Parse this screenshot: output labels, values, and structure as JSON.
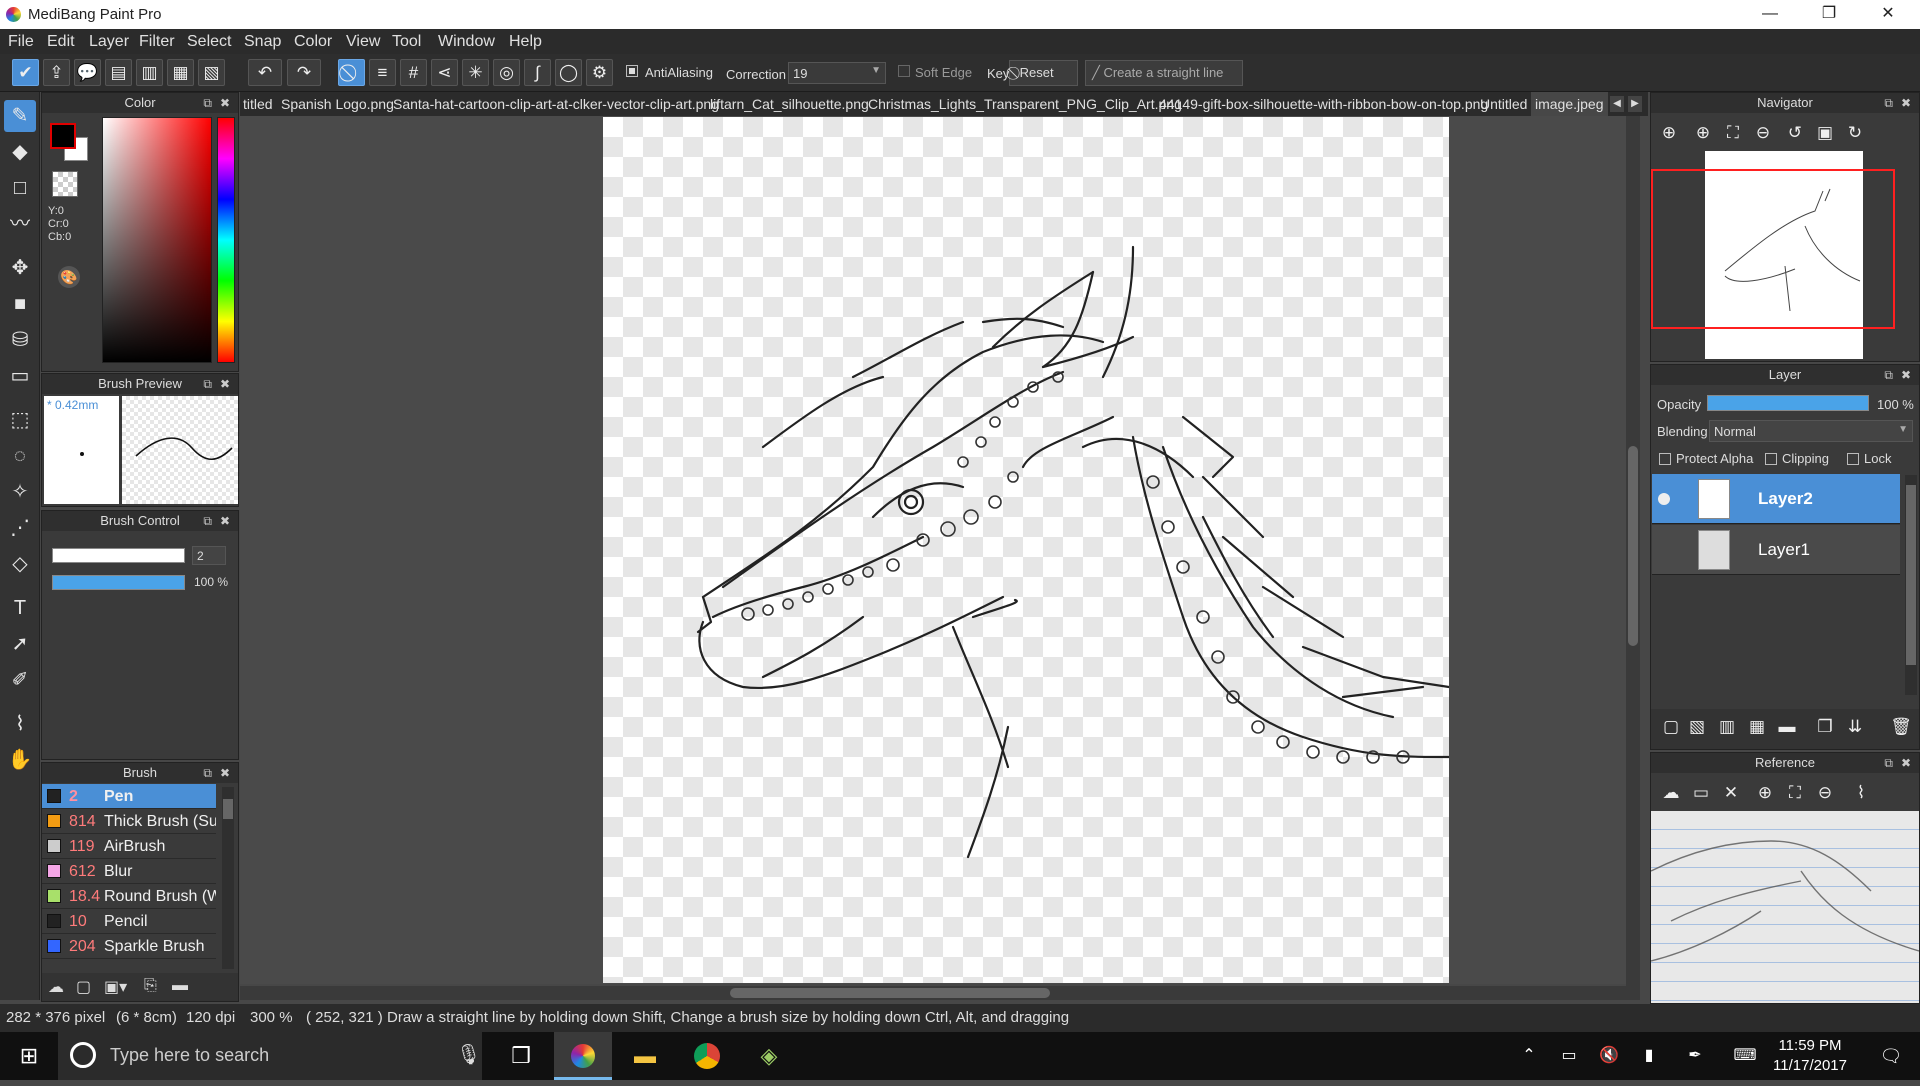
{
  "app": {
    "title": "MediBang Paint Pro"
  },
  "window_controls": {
    "minimize": "—",
    "maximize": "❐",
    "close": "✕"
  },
  "menu": [
    "File",
    "Edit",
    "Layer",
    "Filter",
    "Select",
    "Snap",
    "Color",
    "View",
    "Tool",
    "Window",
    "Help"
  ],
  "toolbar": {
    "antialiasing_label": "AntiAliasing",
    "correction_label": "Correction",
    "correction_value": "19",
    "soft_edge_label": "Soft Edge",
    "key_label": "Key",
    "reset_label": "Reset",
    "straight_line_label": "Create a straight line"
  },
  "tabs": [
    "titled",
    "Spanish Logo.png",
    "Santa-hat-cartoon-clip-art-at-clker-vector-clip-art.png",
    "liftarn_Cat_silhouette.png",
    "Christmas_Lights_Transparent_PNG_Clip_Art.png",
    "44149-gift-box-silhouette-with-ribbon-bow-on-top.png",
    "Untitled",
    "image.jpeg"
  ],
  "color_panel": {
    "title": "Color",
    "y": "Y:0",
    "cr": "Cr:0",
    "cb": "Cb:0",
    "foreground": "#e00000",
    "background": "#ffffff"
  },
  "brush_preview": {
    "title": "Brush Preview",
    "size": "* 0.42mm"
  },
  "brush_control": {
    "title": "Brush Control",
    "size_value": "2",
    "opacity_value": "100 %"
  },
  "brush_list": {
    "title": "Brush",
    "items": [
      {
        "num": "2",
        "name": "Pen",
        "color": "#222222"
      },
      {
        "num": "814",
        "name": "Thick Brush (Su",
        "color": "#f39c12"
      },
      {
        "num": "119",
        "name": "AirBrush",
        "color": "#cccccc"
      },
      {
        "num": "612",
        "name": "Blur",
        "color": "#f5a6e6"
      },
      {
        "num": "18.4",
        "name": "Round Brush (W",
        "color": "#a8e06a"
      },
      {
        "num": "10",
        "name": "Pencil",
        "color": "#222222"
      },
      {
        "num": "204",
        "name": "Sparkle Brush",
        "color": "#3366ff"
      }
    ]
  },
  "navigator": {
    "title": "Navigator"
  },
  "layer_panel": {
    "title": "Layer",
    "opacity_label": "Opacity",
    "opacity_value": "100 %",
    "blending_label": "Blending",
    "blending_value": "Normal",
    "protect_alpha": "Protect Alpha",
    "clipping": "Clipping",
    "lock": "Lock",
    "layers": [
      "Layer2",
      "Layer1"
    ]
  },
  "reference": {
    "title": "Reference"
  },
  "status": {
    "size": "282 * 376 pixel",
    "cm": "(6 * 8cm)",
    "dpi": "120 dpi",
    "zoom": "300 %",
    "coords": "( 252, 321 )",
    "hint": "Draw a straight line by holding down Shift, Change a brush size by holding down Ctrl, Alt, and dragging"
  },
  "taskbar": {
    "search_placeholder": "Type here to search",
    "time": "11:59 PM",
    "date": "11/17/2017"
  }
}
